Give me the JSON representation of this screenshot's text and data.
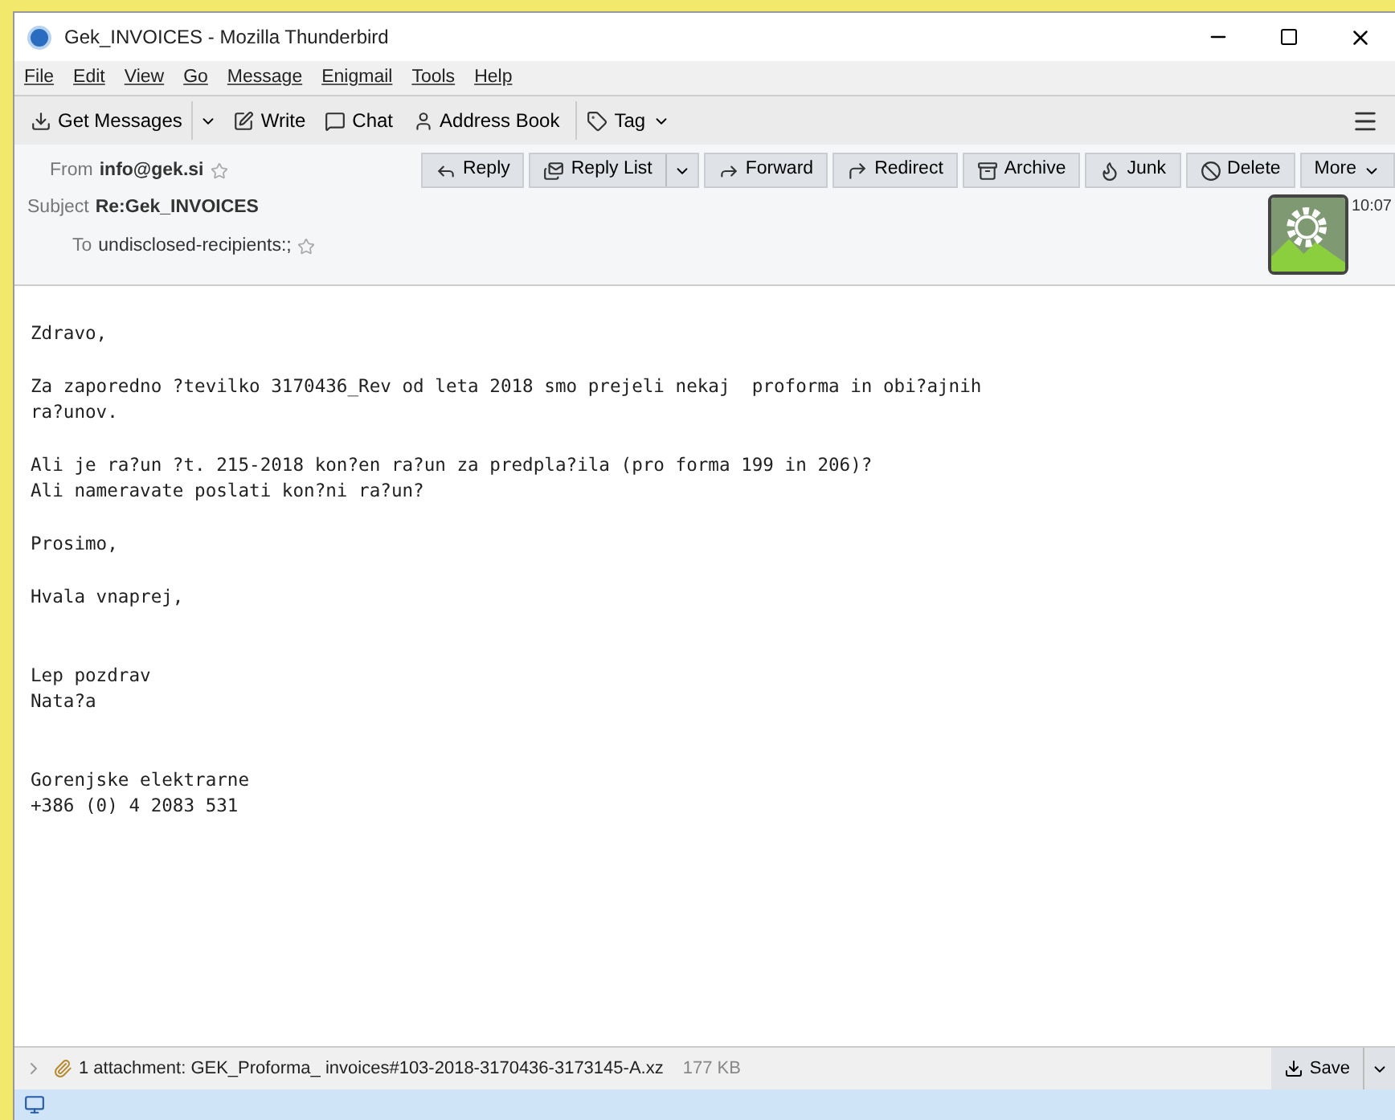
{
  "window": {
    "title": "Gek_INVOICES - Mozilla Thunderbird"
  },
  "menu": [
    "File",
    "Edit",
    "View",
    "Go",
    "Message",
    "Enigmail",
    "Tools",
    "Help"
  ],
  "toolbar": [
    {
      "label": "Get Messages",
      "kind": "split"
    },
    {
      "label": "Write",
      "kind": "button"
    },
    {
      "label": "Chat",
      "kind": "button"
    },
    {
      "label": "Address Book",
      "kind": "button"
    },
    {
      "label": "Tag",
      "kind": "menu"
    }
  ],
  "header": {
    "from_label": "From",
    "from": "info@gek.si",
    "subject_label": "Subject",
    "subject": "Re:Gek_INVOICES",
    "to_label": "To",
    "to": "undisclosed-recipients:;",
    "time": "10:07",
    "actions": [
      {
        "label": "Reply",
        "kind": "button"
      },
      {
        "label": "Reply List",
        "kind": "split"
      },
      {
        "label": "Forward",
        "kind": "button"
      },
      {
        "label": "Redirect",
        "kind": "button"
      },
      {
        "label": "Archive",
        "kind": "button"
      },
      {
        "label": "Junk",
        "kind": "button"
      },
      {
        "label": "Delete",
        "kind": "button"
      },
      {
        "label": "More",
        "kind": "menu"
      }
    ]
  },
  "body": [
    [
      "Zdravo,"
    ],
    [
      "Za zaporedno ?tevilko 3170436_Rev od leta 2018 smo prejeli nekaj  proforma in obi?ajnih",
      "ra?unov."
    ],
    [
      "Ali je ra?un ?t. 215-2018 kon?en ra?un za predpla?ila (pro forma 199 in 206)?",
      "Ali nameravate poslati kon?ni ra?un?"
    ],
    [
      "Prosimo,"
    ],
    [
      "Hvala vnaprej,"
    ],
    [
      "Lep pozdrav",
      "Nata?a"
    ],
    [
      "Gorenjske elektrarne",
      "+386 (0) 4 2083 531"
    ]
  ],
  "attachment": {
    "summary": "1 attachment: GEK_Proforma_ invoices#103-2018-3170436-3173145-A.xz",
    "size": "177 KB",
    "save": "Save"
  }
}
